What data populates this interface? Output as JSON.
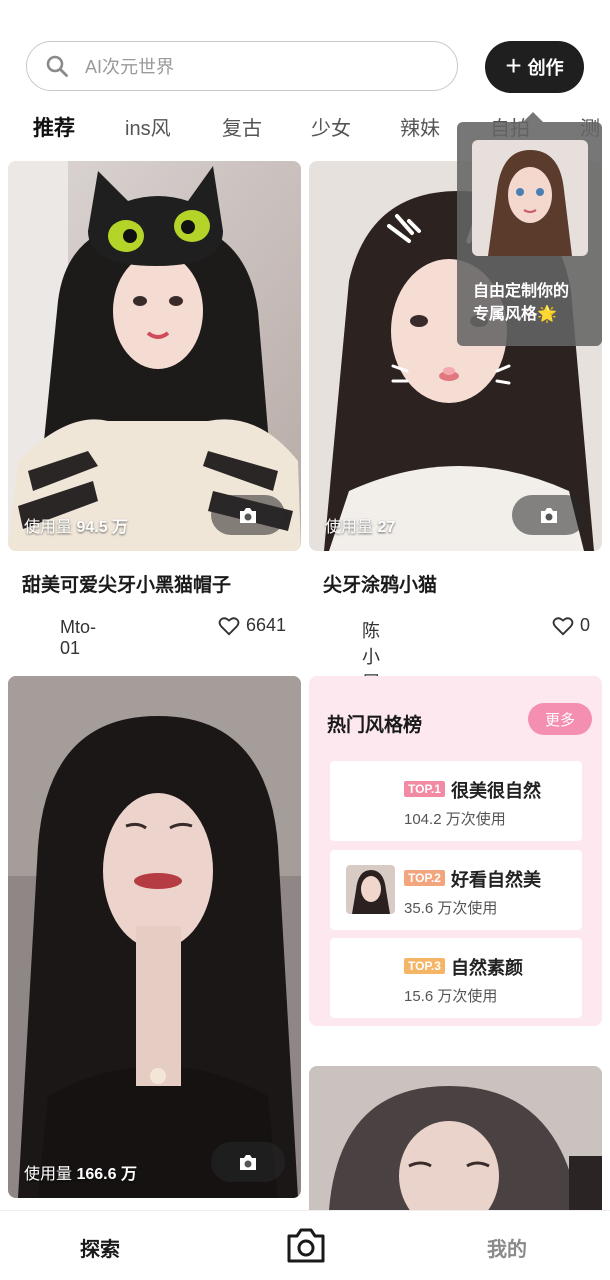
{
  "search": {
    "placeholder": "AI次元世界"
  },
  "header": {
    "create_label": "创作"
  },
  "tabs": [
    "推荐",
    "ins风",
    "复古",
    "少女",
    "辣妹",
    "自拍",
    "测"
  ],
  "popover": {
    "text_line1": "自由定制你的",
    "text_line2": "专属风格🌟"
  },
  "cards": [
    {
      "usage_label": "使用量",
      "usage_value": "94.5 万",
      "title": "甜美可爱尖牙小黑猫帽子",
      "author": "Mto-01",
      "likes": "6641"
    },
    {
      "usage_label": "使用量",
      "usage_value": "27",
      "title": "尖牙涂鸦小猫",
      "author": "陈小屁o",
      "likes": "0"
    },
    {
      "usage_label": "使用量",
      "usage_value": "166.6 万"
    }
  ],
  "ranking": {
    "title": "热门风格榜",
    "more_label": "更多",
    "items": [
      {
        "badge": "TOP.1",
        "name": "很美很自然",
        "usage": "104.2 万次使用",
        "badge_color": "#f28aa3"
      },
      {
        "badge": "TOP.2",
        "name": "好看自然美",
        "usage": "35.6 万次使用",
        "badge_color": "#f3a57d"
      },
      {
        "badge": "TOP.3",
        "name": "自然素颜",
        "usage": "15.6 万次使用",
        "badge_color": "#f5b566"
      }
    ]
  },
  "bottom_nav": {
    "explore": "探索",
    "mine": "我的",
    "camera_icon": "camera-icon"
  },
  "colors": {
    "accent_pink": "#f58fb1",
    "panel_pink": "#fde8ef",
    "dark_button": "#1f1f1f"
  }
}
